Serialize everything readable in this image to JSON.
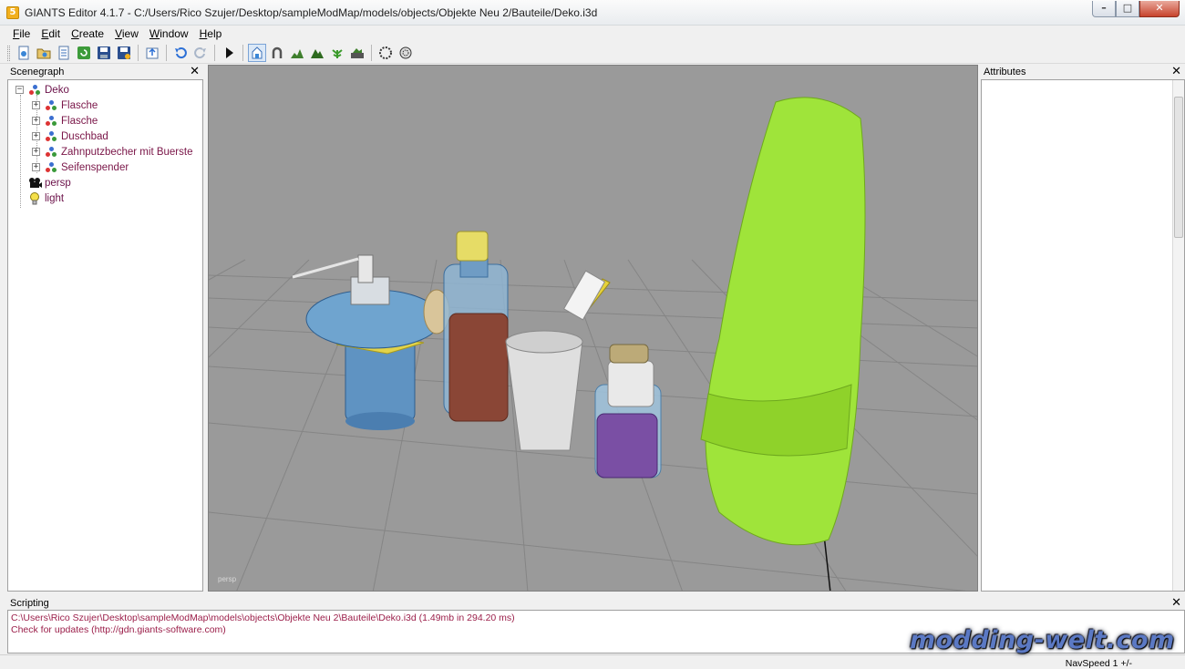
{
  "window": {
    "title": "GIANTS Editor 4.1.7 - C:/Users/Rico Szujer/Desktop/sampleModMap/models/objects/Objekte Neu 2/Bauteile/Deko.i3d",
    "app_icon_letter": "5",
    "minimize": "–",
    "maximize": "□",
    "close": "✕"
  },
  "menu": [
    {
      "underline": "F",
      "rest": "ile"
    },
    {
      "underline": "E",
      "rest": "dit"
    },
    {
      "underline": "C",
      "rest": "reate"
    },
    {
      "underline": "V",
      "rest": "iew"
    },
    {
      "underline": "W",
      "rest": "indow"
    },
    {
      "underline": "H",
      "rest": "elp"
    }
  ],
  "toolbar_icons": [
    "new-scene-icon",
    "open-icon",
    "import-icon",
    "refresh-icon",
    "save-icon",
    "save-as-icon",
    "export-icon",
    "undo-icon",
    "redo-icon",
    "play-icon",
    "select-mode-icon",
    "magnet-icon",
    "terrain-sculpt-icon",
    "terrain-paint-icon",
    "foliage-paint-icon",
    "terrain-fill-icon",
    "particle-icon",
    "navmesh-icon"
  ],
  "scenegraph": {
    "title": "Scenegraph",
    "close": "✕",
    "root": "Deko",
    "children": [
      "Flasche",
      "Flasche",
      "Duschbad",
      "Zahnputzbecher mit Buerste",
      "Seifenspender"
    ],
    "camera": "persp",
    "light": "light",
    "expand_symbol": "+",
    "collapse_symbol": "−"
  },
  "viewport": {
    "camera_label": "persp",
    "background_color": "#9a9a9a"
  },
  "attributes": {
    "title": "Attributes",
    "close": "✕"
  },
  "scripting": {
    "title": "Scripting",
    "close": "✕",
    "lines": [
      "C:\\Users\\Rico Szujer\\Desktop\\sampleModMap\\models\\objects\\Objekte Neu 2\\Bauteile\\Deko.i3d (1.49mb in 294.20 ms)",
      "Check for updates (http://gdn.giants-software.com)"
    ]
  },
  "status": {
    "navspeed": "NavSpeed 1 +/-"
  },
  "watermark": "modding-welt.com"
}
